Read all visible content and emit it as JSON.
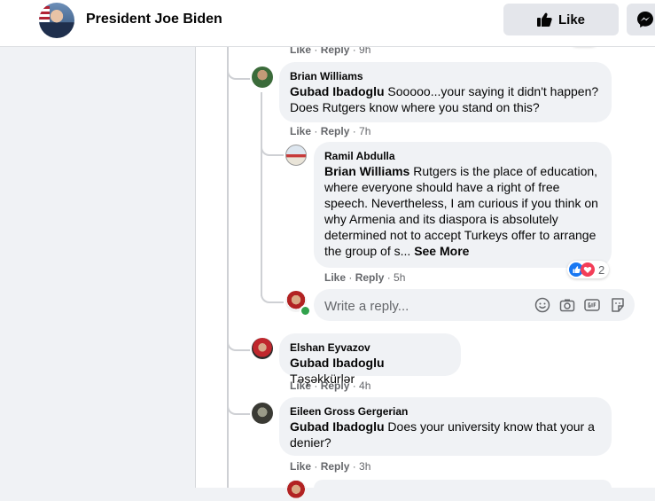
{
  "header": {
    "page_name": "President Joe Biden",
    "like_label": "Like"
  },
  "top_actions": {
    "like": "Like",
    "reply": "Reply",
    "time": "9h"
  },
  "comments": [
    {
      "author": "Brian Williams",
      "mention": "Gubad Ibadoglu",
      "text": " Sooooo...your saying it didn't happen? Does Rutgers know where you stand on this?",
      "like": "Like",
      "reply": "Reply",
      "time": "7h"
    },
    {
      "author": "Ramil Abdulla",
      "mention": "Brian Williams",
      "text": " Rutgers is the place of education, where everyone should have a right of free speech. Nevertheless, I am curious if you think on why Armenia and its diaspora is absolutely determined not to accept Turkeys offer to arrange the group of s...",
      "see_more": "See More",
      "like": "Like",
      "reply": "Reply",
      "time": "5h",
      "reaction_count": "2"
    },
    {
      "author": "Elshan Eyvazov",
      "mention": "Gubad Ibadoglu",
      "text": " Təşəkkürlər",
      "like": "Like",
      "reply": "Reply",
      "time": "4h"
    },
    {
      "author": "Eileen Gross Gergerian",
      "mention": "Gubad Ibadoglu",
      "text": " Does your university know that your a denier?",
      "like": "Like",
      "reply": "Reply",
      "time": "3h"
    }
  ],
  "reply_box": {
    "placeholder": "Write a reply..."
  },
  "colors": {
    "background": "#f0f2f5",
    "card": "#ffffff",
    "bubble": "#f0f2f5",
    "secondary_text": "#65676b",
    "like_blue": "#1877f2",
    "love_red": "#f33e58",
    "online_green": "#31a24c"
  },
  "icons": [
    "thumbs-up-icon",
    "messenger-icon",
    "emoji-icon",
    "camera-icon",
    "gif-icon",
    "sticker-icon",
    "like-reaction-icon",
    "love-reaction-icon"
  ]
}
